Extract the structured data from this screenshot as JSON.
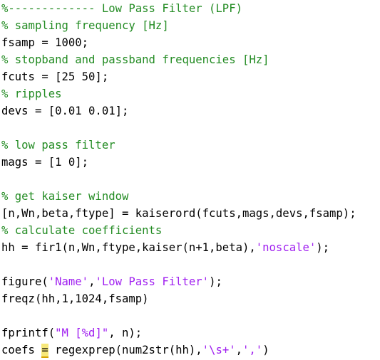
{
  "editor": {
    "lines": [
      [
        {
          "t": "%------------- Low Pass Filter (LPF)",
          "k": "comment"
        }
      ],
      [
        {
          "t": "% sampling frequency [Hz]",
          "k": "comment"
        }
      ],
      [
        {
          "t": "fsamp = 1000;",
          "k": "code"
        }
      ],
      [
        {
          "t": "% stopband and passband frequencies [Hz]",
          "k": "comment"
        }
      ],
      [
        {
          "t": "fcuts = [25 50];",
          "k": "code"
        }
      ],
      [
        {
          "t": "% ripples",
          "k": "comment"
        }
      ],
      [
        {
          "t": "devs = [0.01 0.01];",
          "k": "code"
        }
      ],
      [],
      [
        {
          "t": "% low pass filter",
          "k": "comment"
        }
      ],
      [
        {
          "t": "mags = [1 0];",
          "k": "code"
        }
      ],
      [],
      [
        {
          "t": "% get kaiser window",
          "k": "comment"
        }
      ],
      [
        {
          "t": "[n,Wn,beta,ftype] = kaiserord(fcuts,mags,devs,fsamp);",
          "k": "code"
        }
      ],
      [
        {
          "t": "% calculate coefficients",
          "k": "comment"
        }
      ],
      [
        {
          "t": "hh = fir1(n,Wn,ftype,kaiser(n+1,beta),",
          "k": "code"
        },
        {
          "t": "'noscale'",
          "k": "string"
        },
        {
          "t": ");",
          "k": "code"
        }
      ],
      [],
      [
        {
          "t": "figure(",
          "k": "code"
        },
        {
          "t": "'Name'",
          "k": "string"
        },
        {
          "t": ",",
          "k": "code"
        },
        {
          "t": "'Low Pass Filter'",
          "k": "string"
        },
        {
          "t": ");",
          "k": "code"
        }
      ],
      [
        {
          "t": "freqz(hh,1,1024,fsamp)",
          "k": "code"
        }
      ],
      [],
      [
        {
          "t": "fprintf(",
          "k": "code"
        },
        {
          "t": "\"M [%d]\"",
          "k": "string"
        },
        {
          "t": ", n);",
          "k": "code"
        }
      ],
      [
        {
          "t": "coefs ",
          "k": "code"
        },
        {
          "t": "=",
          "k": "warn"
        },
        {
          "t": " regexprep(num2str(hh),",
          "k": "code"
        },
        {
          "t": "'\\s+'",
          "k": "string"
        },
        {
          "t": ",",
          "k": "code"
        },
        {
          "t": "','",
          "k": "string"
        },
        {
          "t": ")",
          "k": "code"
        }
      ]
    ]
  },
  "colors": {
    "comment": "#228b22",
    "string": "#a020f0",
    "code": "#000000",
    "warning_highlight": "#f7e87a",
    "background": "#ffffff"
  }
}
